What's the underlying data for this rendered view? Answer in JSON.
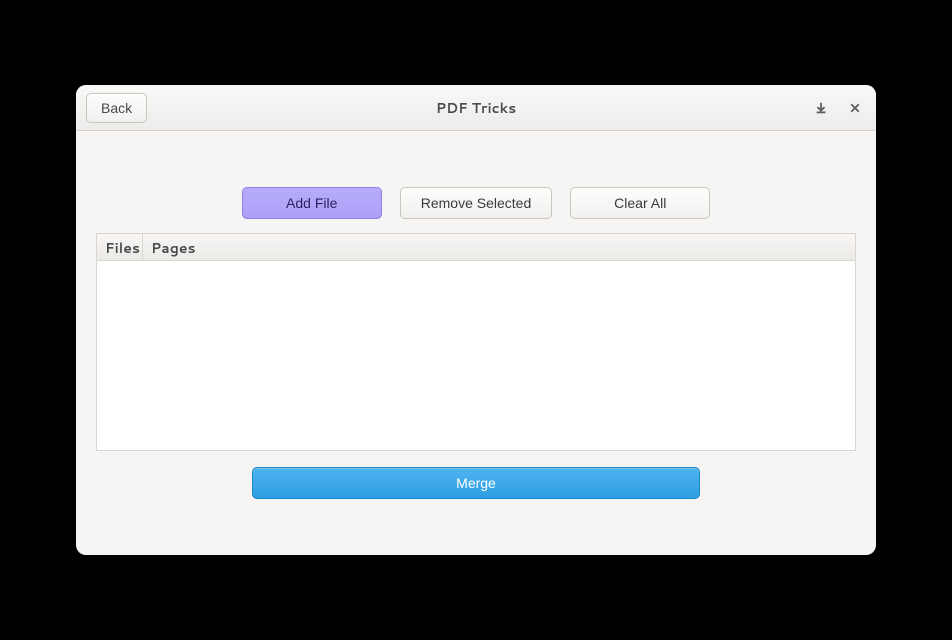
{
  "header": {
    "back_label": "Back",
    "title": "PDF Tricks"
  },
  "toolbar": {
    "add_file_label": "Add File",
    "remove_selected_label": "Remove Selected",
    "clear_all_label": "Clear All"
  },
  "table": {
    "columns": {
      "files": "Files",
      "pages": "Pages"
    }
  },
  "actions": {
    "merge_label": "Merge"
  },
  "icons": {
    "download": "download-icon",
    "close": "close-icon"
  }
}
